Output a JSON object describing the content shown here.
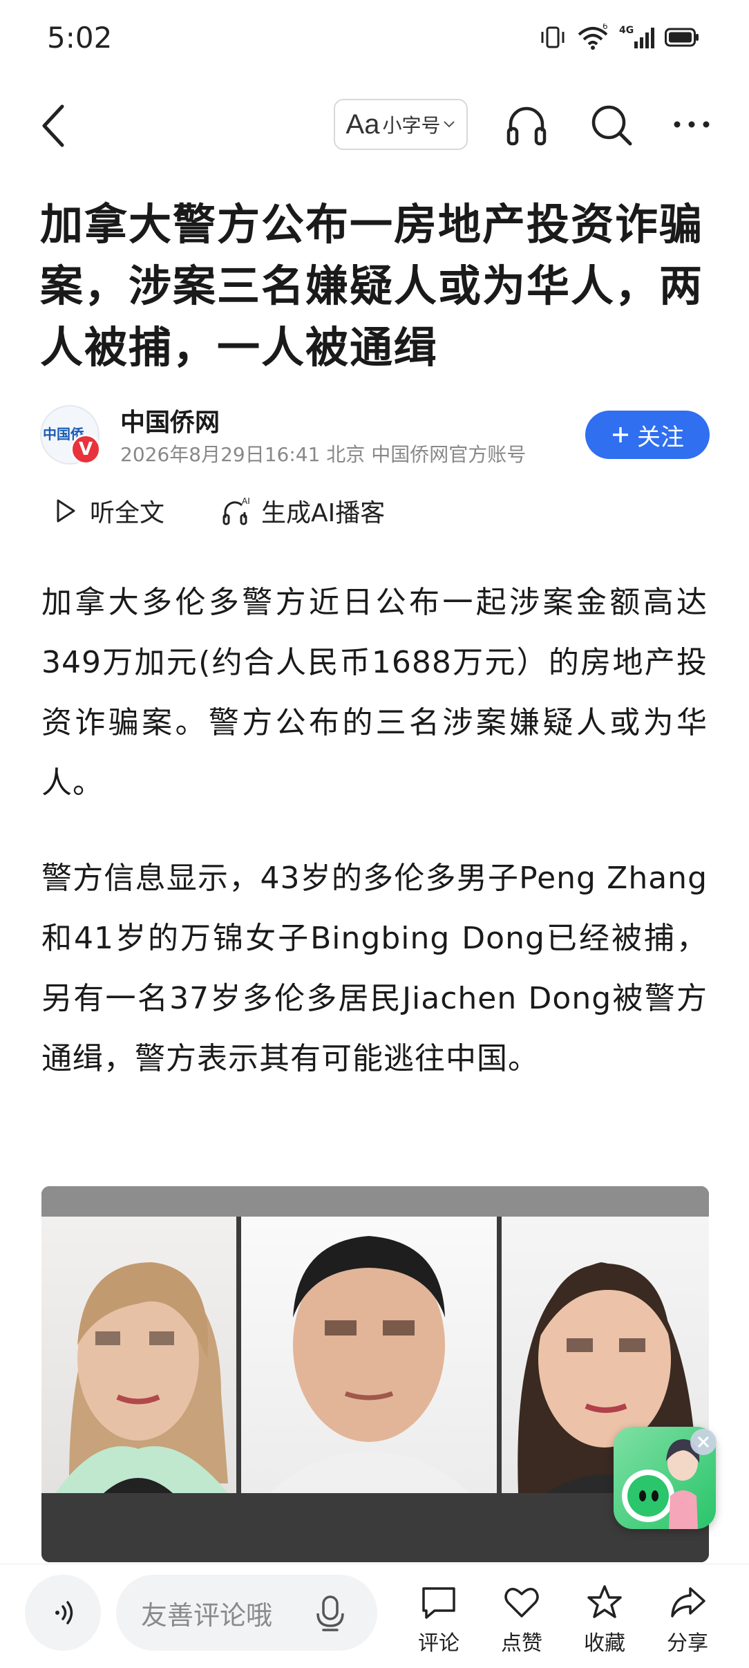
{
  "status_bar": {
    "time": "5:02",
    "signal_badge": "6",
    "network": "4G"
  },
  "top_bar": {
    "font_size_aa": "Aa",
    "font_size_label": "小字号",
    "icons": [
      "back-arrow-icon",
      "headphones-icon",
      "search-icon",
      "more-dots-icon"
    ]
  },
  "article": {
    "title": "加拿大警方公布一房地产投资诈骗案，涉案三名嫌疑人或为华人，两人被捕，一人被通缉",
    "author": {
      "name": "中国侨网",
      "logo_text": "中国侨",
      "verified_badge": "V",
      "meta": "2026年8月29日16:41 北京 中国侨网官方账号"
    },
    "follow_label": "关注",
    "listen_label": "听全文",
    "podcast_label": "生成AI播客",
    "podcast_ai_tag": "AI",
    "paragraphs": [
      "加拿大多伦多警方近日公布一起涉案金额高达349万加元(约合人民币1688万元）的房地产投资诈骗案。警方公布的三名涉案嫌疑人或为华人。",
      "警方信息显示，43岁的多伦多男子Peng Zhang和41岁的万锦女子Bingbing Dong已经被捕，另有一名37岁多伦多居民Jiachen Dong被警方通缉，警方表示其有可能逃往中国。"
    ]
  },
  "bottom_bar": {
    "comment_placeholder": "友善评论哦",
    "comment_label": "评论",
    "like_label": "点赞",
    "favorite_label": "收藏",
    "share_label": "分享"
  },
  "colors": {
    "accent": "#2f6ff0",
    "verified": "#e8323c",
    "widget_green": "#29c46a"
  }
}
